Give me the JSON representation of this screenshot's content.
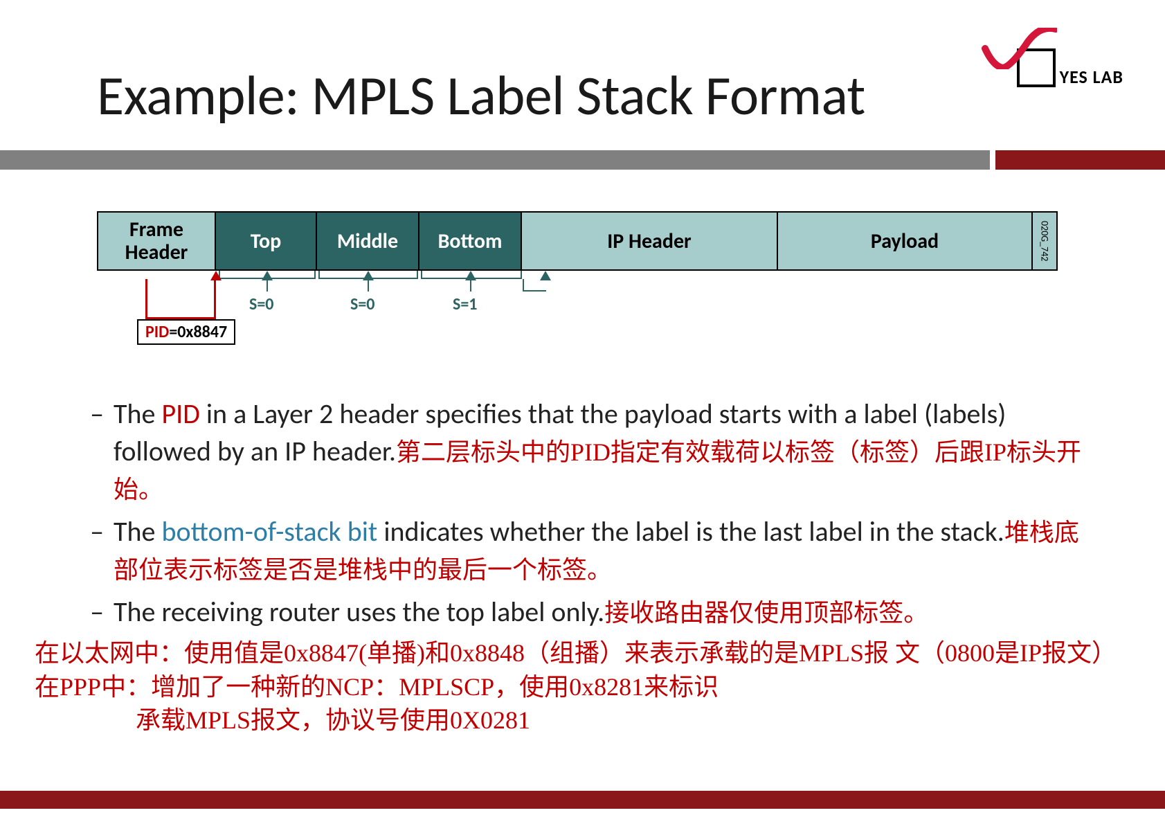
{
  "title": "Example: MPLS Label Stack Format",
  "logo_text": "YES LAB",
  "diagram": {
    "cells": {
      "frame": "Frame\nHeader",
      "top": "Top",
      "middle": "Middle",
      "bottom": "Bottom",
      "ip": "IP Header",
      "payload": "Payload"
    },
    "side_note": "020G_742",
    "pid_key": "PID",
    "pid_value": "=0x8847",
    "s_labels": {
      "s0a": "S=0",
      "s0b": "S=0",
      "s1": "S=1"
    }
  },
  "bullets": [
    {
      "parts": [
        {
          "t": "The ",
          "cls": "grey"
        },
        {
          "t": "PID",
          "cls": "redlatin"
        },
        {
          "t": " in a Layer 2 header specifies that the payload  starts with a label (labels) followed by an IP header.",
          "cls": "grey"
        },
        {
          "t": "第二层标头中的PID指定有效载荷以标签（标签）后跟IP标头开始。",
          "cls": "red"
        }
      ]
    },
    {
      "parts": [
        {
          "t": "The ",
          "cls": "grey"
        },
        {
          "t": "bottom-of-stack bit",
          "cls": "teal"
        },
        {
          "t": " indicates whether the label is  the last label in the stack.",
          "cls": "grey"
        },
        {
          "t": "堆栈底部位表示标签是否是堆栈中的最后一个标签。",
          "cls": "red"
        }
      ]
    },
    {
      "parts": [
        {
          "t": "The receiving router uses the top label only.",
          "cls": "grey"
        },
        {
          "t": "接收路由器仅使用顶部标签。",
          "cls": "red"
        }
      ]
    }
  ],
  "footer_cn": {
    "line1": "在以太网中：使用值是0x8847(单播)和0x8848（组播）来表示承载的是MPLS报    文（0800是IP报文）    在PPP中：增加了一种新的NCP：MPLSCP，使用0x8281来标识",
    "line2": "承载MPLS报文，协议号使用0X0281"
  }
}
